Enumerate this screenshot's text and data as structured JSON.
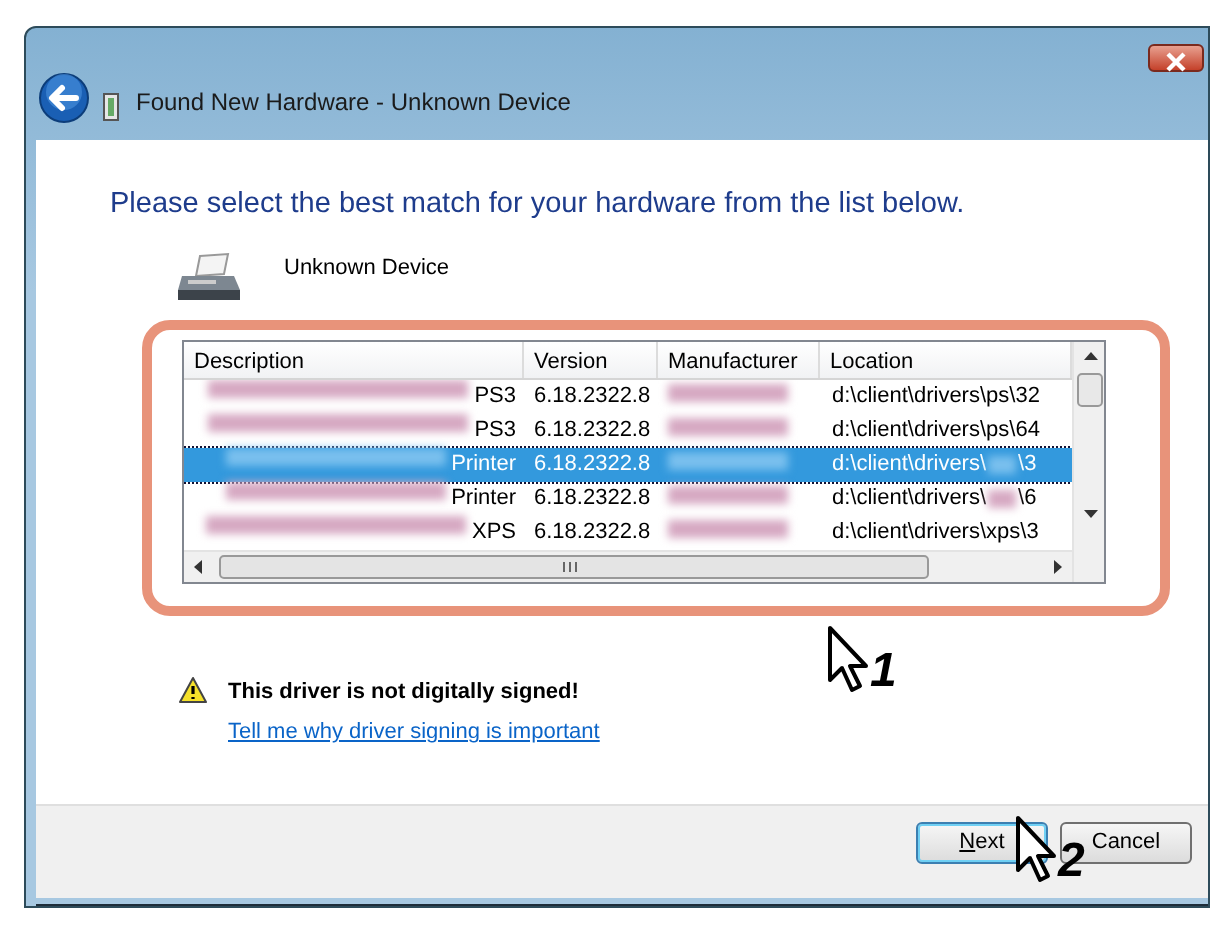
{
  "window": {
    "title": "Found New Hardware - Unknown Device"
  },
  "heading": "Please select the best match for your hardware from the list below.",
  "device": {
    "name": "Unknown Device"
  },
  "driver_list": {
    "columns": [
      "Description",
      "Version",
      "Manufacturer",
      "Location"
    ],
    "rows": [
      {
        "description": "PS3",
        "version": "6.18.2322.8",
        "location": "d:\\client\\drivers\\ps\\32",
        "selected": false
      },
      {
        "description": "PS3",
        "version": "6.18.2322.8",
        "location": "d:\\client\\drivers\\ps\\64",
        "selected": false
      },
      {
        "description": "Printer",
        "version": "6.18.2322.8",
        "location": "d:\\client\\drivers\\",
        "location_tail": "\\3",
        "selected": true
      },
      {
        "description": "Printer",
        "version": "6.18.2322.8",
        "location": "d:\\client\\drivers\\",
        "location_tail": "\\6",
        "selected": false
      },
      {
        "description": "XPS",
        "version": "6.18.2322.8",
        "location": "d:\\client\\drivers\\xps\\3",
        "selected": false
      }
    ]
  },
  "warning": {
    "text": "This driver is not digitally signed!",
    "link": "Tell me why driver signing is important"
  },
  "buttons": [
    {
      "mnemonic": "N",
      "label": "ext",
      "default": true
    },
    {
      "label": "Cancel",
      "default": false
    }
  ],
  "annotations": [
    {
      "label": "1"
    },
    {
      "label": "2"
    }
  ]
}
